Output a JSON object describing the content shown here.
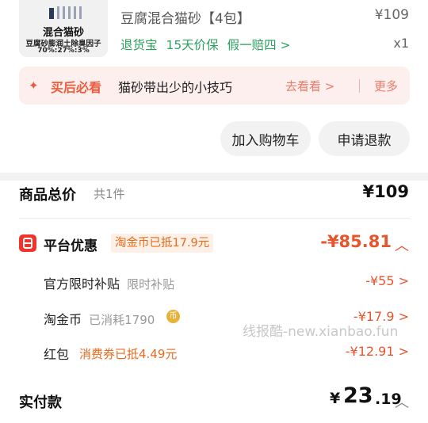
{
  "product": {
    "thumb_title": "混合猫砂",
    "thumb_line2": "豆腐砂膨润土除臭因子",
    "thumb_ratio": "70%:27%:3%",
    "title": "豆腐混合猫砂【4包】",
    "price": "¥109",
    "guarantees": [
      "退货宝",
      "15天价保",
      "假一赔四 >"
    ],
    "quantity": "x1"
  },
  "tips": {
    "prefix": "买后必看",
    "text": "猫砂带出少的小技巧",
    "goto": "去看看 >",
    "more": "更多"
  },
  "actions": {
    "add_cart": "加入购物车",
    "refund": "申请退款"
  },
  "summary": {
    "label": "商品总价",
    "count": "共1件",
    "value": "¥109"
  },
  "discount": {
    "label": "平台优惠",
    "tag": "淘金币已抵17.9元",
    "value": "-¥85.81",
    "rows": [
      {
        "label": "官方限时补贴",
        "sub": "限时补贴",
        "value": "-¥55 >"
      },
      {
        "label": "淘金币",
        "sub": "已消耗1790",
        "value": "-¥17.9 >"
      },
      {
        "label": "红包",
        "sub": "消费券已抵4.49元",
        "value": "-¥12.91 >"
      }
    ]
  },
  "watermark": "线报酷-new.xianbao.fun",
  "payment": {
    "label": "实付款",
    "currency": "¥",
    "int": "23",
    "dec": ".19"
  }
}
